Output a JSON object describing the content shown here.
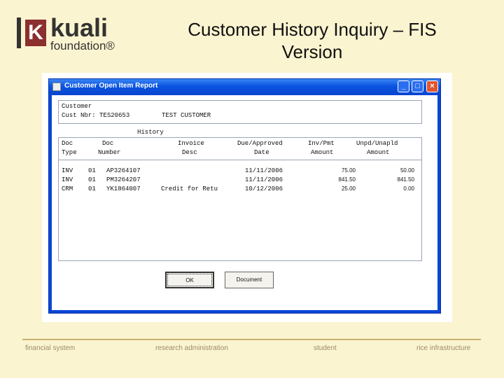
{
  "logo": {
    "word": "kuali",
    "sub": "foundation®"
  },
  "slide": {
    "title_line1": "Customer History Inquiry – FIS",
    "title_line2": "Version"
  },
  "window": {
    "title": "Customer Open Item Report",
    "controls": {
      "minimize": "_",
      "maximize": "□",
      "close": "×"
    }
  },
  "customer_box": {
    "label": "Customer",
    "cust_nbr_label": "Cust Nbr:",
    "cust_nbr": "TES20653",
    "cust_name": "TEST CUSTOMER"
  },
  "history_label": "History",
  "table": {
    "headers": [
      {
        "line1": "Doc",
        "line2": "Type"
      },
      {
        "line1": "Doc",
        "line2": "Number"
      },
      {
        "line1": "Invoice",
        "line2": "Desc"
      },
      {
        "line1": "Due/Approved",
        "line2": "Date"
      },
      {
        "line1": "Inv/Pmt",
        "line2": "Amount"
      },
      {
        "line1": "Unpd/Unapld",
        "line2": "Amount"
      }
    ],
    "rows": [
      {
        "type": "INV",
        "nbr_prefix": "01",
        "number": "AP3264107",
        "desc": "",
        "date": "11/11/2006",
        "inv_amt": "75.00",
        "unpd_amt": "50.00"
      },
      {
        "type": "INV",
        "nbr_prefix": "01",
        "number": "PM3264207",
        "desc": "",
        "date": "11/11/2006",
        "inv_amt": "841.50",
        "unpd_amt": "841.50"
      },
      {
        "type": "CRM",
        "nbr_prefix": "01",
        "number": "YK1864007",
        "desc": "Credit for Retu",
        "date": "10/12/2006",
        "inv_amt": "25.00",
        "unpd_amt": "0.00"
      }
    ]
  },
  "buttons": {
    "ok": "OK",
    "document": "Document"
  },
  "footer": {
    "items": [
      "financial system",
      "research administration",
      "student",
      "rice infrastructure"
    ]
  }
}
